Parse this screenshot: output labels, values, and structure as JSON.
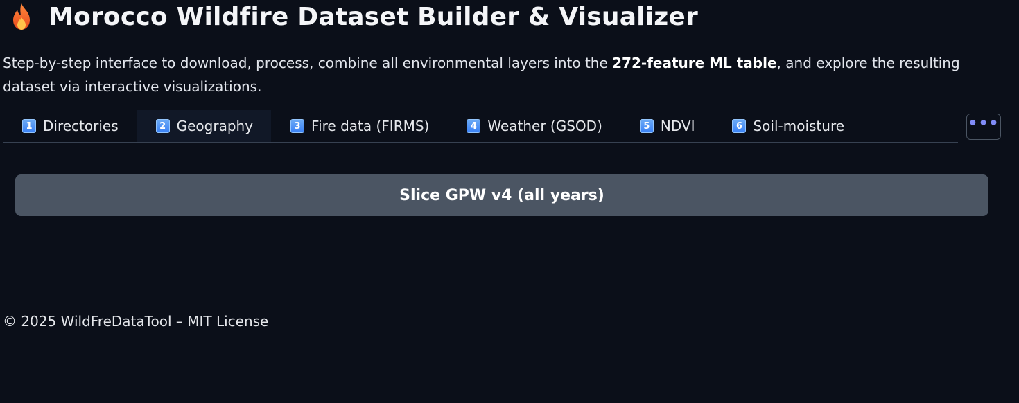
{
  "header": {
    "icon": "flame-icon",
    "title": "Morocco Wildfire Dataset Builder & Visualizer"
  },
  "subtitle": {
    "before": "Step-by-step interface to download, process, combine all environmental layers into the ",
    "bold": "272-feature ML table",
    "after": ", and explore the resulting dataset via interactive visualizations."
  },
  "tabs": [
    {
      "num": "1",
      "label": "Directories",
      "active": false
    },
    {
      "num": "2",
      "label": "Geography",
      "active": true
    },
    {
      "num": "3",
      "label": "Fire data (FIRMS)",
      "active": false
    },
    {
      "num": "4",
      "label": "Weather (GSOD)",
      "active": false
    },
    {
      "num": "5",
      "label": "NDVI",
      "active": false
    },
    {
      "num": "6",
      "label": "Soil-moisture",
      "active": false
    }
  ],
  "more_button": {
    "label": "•••"
  },
  "main": {
    "action_button_label": "Slice GPW v4 (all years)"
  },
  "footer": {
    "text": "© 2025 WildFreDataTool – MIT License"
  },
  "colors": {
    "background": "#0b0f19",
    "active_tab": "#111827",
    "button": "#4b5563",
    "accent": "#818cf8",
    "tab_number_badge": "#3b82f6"
  }
}
